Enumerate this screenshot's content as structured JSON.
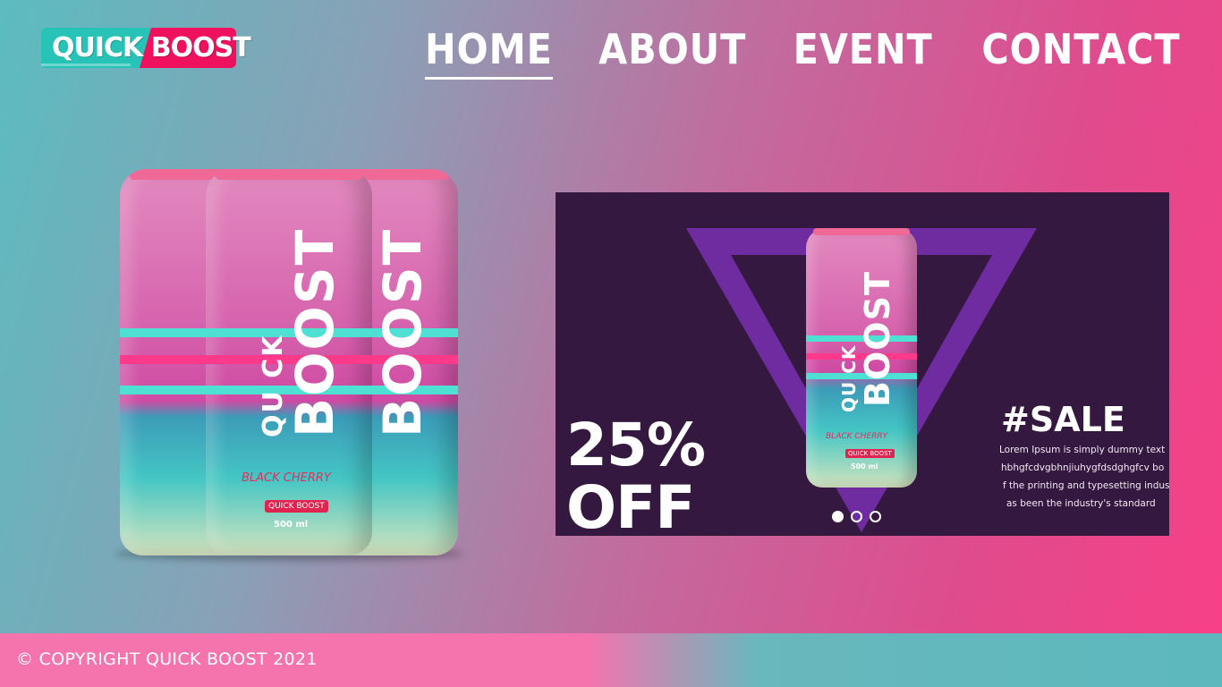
{
  "brand": {
    "logo_text": "QUICK BOOST",
    "colors": {
      "teal": "#27c3b7",
      "pink": "#f0115e",
      "promo_bg": "#35183f",
      "triangle": "#6f2ca0"
    }
  },
  "nav": {
    "items": [
      {
        "label": "HOME",
        "active": true
      },
      {
        "label": "ABOUT",
        "active": false
      },
      {
        "label": "EVENT",
        "active": false
      },
      {
        "label": "CONTACT",
        "active": false
      }
    ]
  },
  "hero": {
    "product_brand_top": "QU CK",
    "product_brand_bottom": "BOOST",
    "flavor": "BLACK CHERRY",
    "tag": "QUICK BOOST",
    "volume": "500 ml"
  },
  "promo": {
    "discount_line1": "25%",
    "discount_line2": "OFF",
    "sale_title": "#SALE",
    "sale_text_lines": [
      "Lorem Ipsum is simply dummy text",
      "hbhgfcdvgbhnjiuhygfdsdghgfcv bo",
      "f the printing and typesetting industr",
      "as been the industry's standard"
    ],
    "slider_dots": 3,
    "active_dot": 0
  },
  "footer": {
    "copyright": "© COPYRIGHT QUICK BOOST 2021"
  }
}
